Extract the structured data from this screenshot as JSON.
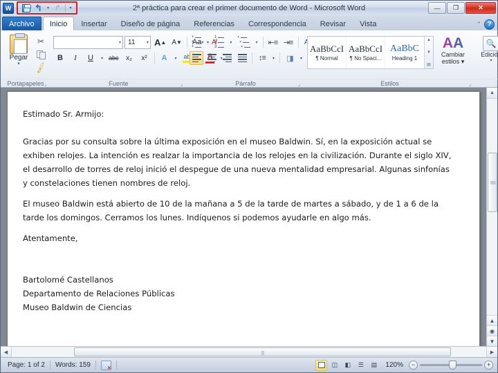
{
  "window": {
    "title": "2ª práctica para crear el primer documento de Word - Microsoft Word",
    "app_logo": "W",
    "minimize": "—",
    "maximize": "❐",
    "close": "✕"
  },
  "quick_access": {
    "save": "save-icon",
    "undo": "↰",
    "redo": "↱",
    "dropdown": "▾",
    "customize": "▾",
    "highlight_color": "#e01b1b"
  },
  "tabs": [
    {
      "label": "Archivo",
      "active": false,
      "is_file": true
    },
    {
      "label": "Inicio",
      "active": true,
      "is_file": false
    },
    {
      "label": "Insertar",
      "active": false,
      "is_file": false
    },
    {
      "label": "Diseño de página",
      "active": false,
      "is_file": false
    },
    {
      "label": "Referencias",
      "active": false,
      "is_file": false
    },
    {
      "label": "Correspondencia",
      "active": false,
      "is_file": false
    },
    {
      "label": "Revisar",
      "active": false,
      "is_file": false
    },
    {
      "label": "Vista",
      "active": false,
      "is_file": false
    }
  ],
  "help": {
    "collapse": "⌃",
    "question": "?"
  },
  "ribbon": {
    "clipboard": {
      "label": "Portapapeles",
      "paste_label": "Pegar",
      "paste_caret": "▾",
      "cut": "✂",
      "copy": "copy-icon",
      "format_painter": "🖌",
      "dialog_launcher": "⌟"
    },
    "font": {
      "label": "Fuente",
      "font_name": "",
      "font_size": "11",
      "caret": "▾",
      "grow_font": "A",
      "shrink_font": "A",
      "change_case": "Aa",
      "clear_formatting": "A̶",
      "bold": "B",
      "italic": "I",
      "underline": "U",
      "strikethrough": "abc",
      "subscript": "x₂",
      "superscript": "x²",
      "text_effects": "A",
      "highlight": "ab",
      "font_color": "A",
      "dialog_launcher": "⌟"
    },
    "paragraph": {
      "label": "Párrafo",
      "bullets": "bullets-icon",
      "numbering": "numbering-icon",
      "multilevel": "multilevel-icon",
      "decrease_indent": "decrease-indent-icon",
      "increase_indent": "increase-indent-icon",
      "sort": "A↓",
      "show_marks": "¶",
      "align_left": "align-left-icon",
      "align_center": "align-center-icon",
      "align_right": "align-right-icon",
      "justify": "justify-icon",
      "line_spacing": "line-spacing-icon",
      "shading": "shading-icon",
      "borders": "borders-icon",
      "dialog_launcher": "⌟",
      "active_alignment": "align_left"
    },
    "styles": {
      "label": "Estilos",
      "items": [
        {
          "preview": "AaBbCcI",
          "name": "¶ Normal",
          "heading": false
        },
        {
          "preview": "AaBbCcI",
          "name": "¶ No Spaci...",
          "heading": false
        },
        {
          "preview": "AaBbC",
          "name": "Heading 1",
          "heading": true
        }
      ],
      "scroll_up": "▲",
      "scroll_down": "▼",
      "more": "▤",
      "change_styles_label": "Cambiar estilos ▾",
      "change_styles_icon": "AA",
      "dialog_launcher": "⌟"
    },
    "editing": {
      "label": "Edición",
      "caret": "▾",
      "icon": "binoculars-icon"
    }
  },
  "document": {
    "salutation": "Estimado Sr. Armijo:",
    "paragraph1": "Gracias por su consulta sobre la última exposición en el museo Baldwin. Sí, en la exposición actual se exhiben relojes. La intención es realzar la importancia de los relojes en la civilización. Durante el siglo XIV, el desarrollo de torres de reloj inició el despegue de una nueva mentalidad empresarial. Algunas sinfonías y constelaciones tienen nombres de reloj.",
    "paragraph2": "El museo Baldwin está abierto de 10 de la mañana a 5 de la tarde de martes a sábado, y de 1 a 6 de la tarde los domingos. Cerramos los lunes. Indíquenos si podemos ayudarle en algo más.",
    "closing": "Atentamente,",
    "signature_name": "Bartolomé Castellanos",
    "signature_dept": "Departamento de Relaciones Públicas",
    "signature_org": "Museo Baldwin de Ciencias"
  },
  "scrollbars": {
    "v_up": "▲",
    "v_down": "▼",
    "prev_page": "▲",
    "select_browse_object": "◉",
    "next_page": "▼",
    "h_left": "◀",
    "h_right": "▶"
  },
  "statusbar": {
    "page": "Page: 1 of 2",
    "words": "Words: 159",
    "proofing": "proofing-errors-icon",
    "views": [
      {
        "name": "print-layout",
        "glyph": "▣",
        "active": true
      },
      {
        "name": "full-screen-reading",
        "glyph": "◫",
        "active": false
      },
      {
        "name": "web-layout",
        "glyph": "◧",
        "active": false
      },
      {
        "name": "outline",
        "glyph": "☰",
        "active": false
      },
      {
        "name": "draft",
        "glyph": "▤",
        "active": false
      }
    ],
    "zoom": "120%",
    "zoom_out": "−",
    "zoom_in": "+"
  }
}
